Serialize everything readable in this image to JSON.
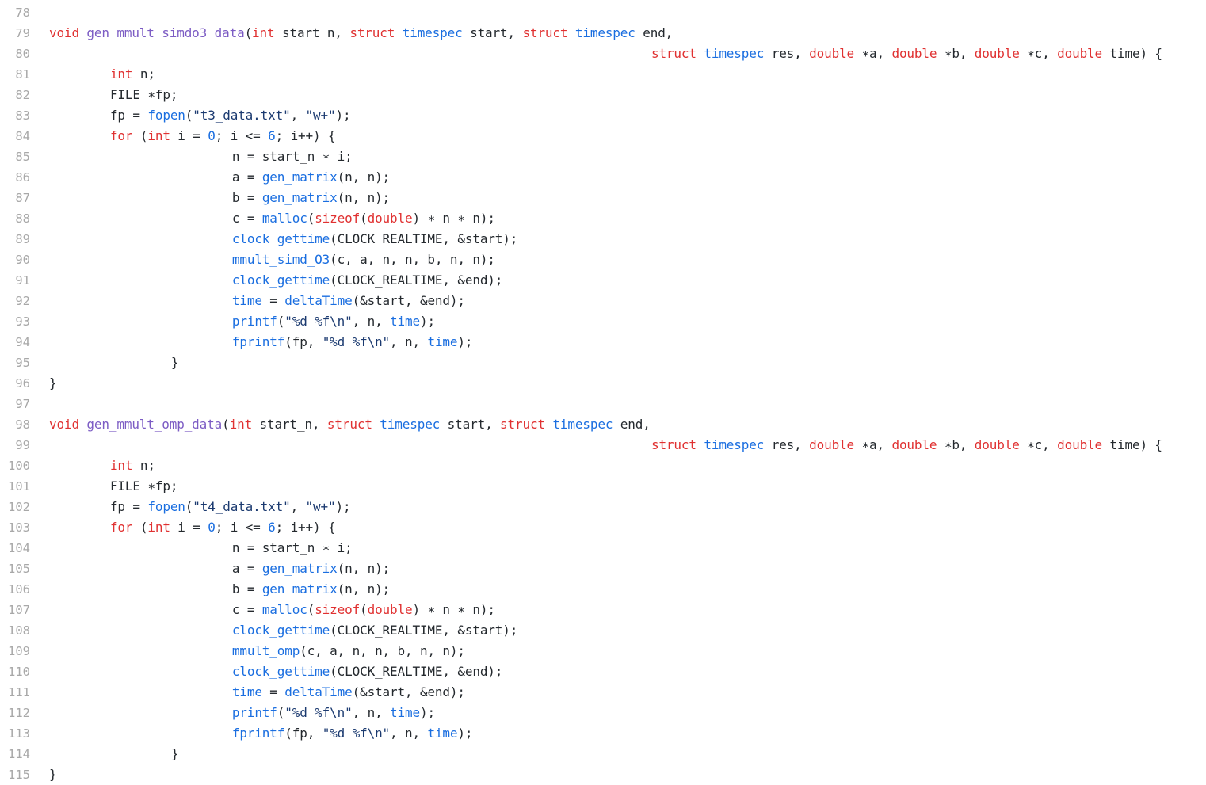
{
  "editor": {
    "language": "C",
    "background": "#ffffff",
    "gutter_color": "#a8a8a8",
    "colors": {
      "plain": "#24292e",
      "keyword": "#e03131",
      "type": "#1a6ee0",
      "function_call": "#1a6ee0",
      "function_def": "#7c5cc4",
      "string": "#1b3a70",
      "number": "#1a6ee0"
    },
    "first_line_number": 78,
    "last_line_number": 115
  },
  "lines": [
    {
      "num": "78",
      "tokens": []
    },
    {
      "num": "79",
      "tokens": [
        {
          "t": "void",
          "c": "keyword"
        },
        {
          "t": " ",
          "c": "plain"
        },
        {
          "t": "gen_mmult_simdo3_data",
          "c": "funcdef"
        },
        {
          "t": "(",
          "c": "plain"
        },
        {
          "t": "int",
          "c": "keyword"
        },
        {
          "t": " start_n, ",
          "c": "plain"
        },
        {
          "t": "struct",
          "c": "keyword"
        },
        {
          "t": " ",
          "c": "plain"
        },
        {
          "t": "timespec",
          "c": "type"
        },
        {
          "t": " start, ",
          "c": "plain"
        },
        {
          "t": "struct",
          "c": "keyword"
        },
        {
          "t": " ",
          "c": "plain"
        },
        {
          "t": "timespec",
          "c": "type"
        },
        {
          "t": " end,",
          "c": "plain"
        }
      ]
    },
    {
      "num": "80",
      "indent": 79,
      "tokens": [
        {
          "t": "struct",
          "c": "keyword"
        },
        {
          "t": " ",
          "c": "plain"
        },
        {
          "t": "timespec",
          "c": "type"
        },
        {
          "t": " res, ",
          "c": "plain"
        },
        {
          "t": "double",
          "c": "keyword"
        },
        {
          "t": " ∗a, ",
          "c": "plain"
        },
        {
          "t": "double",
          "c": "keyword"
        },
        {
          "t": " ∗b, ",
          "c": "plain"
        },
        {
          "t": "double",
          "c": "keyword"
        },
        {
          "t": " ∗c, ",
          "c": "plain"
        },
        {
          "t": "double",
          "c": "keyword"
        },
        {
          "t": " time) {",
          "c": "plain"
        }
      ]
    },
    {
      "num": "81",
      "indent": 8,
      "tokens": [
        {
          "t": "int",
          "c": "keyword"
        },
        {
          "t": " n;",
          "c": "plain"
        }
      ]
    },
    {
      "num": "82",
      "indent": 8,
      "tokens": [
        {
          "t": "FILE ∗fp;",
          "c": "plain"
        }
      ]
    },
    {
      "num": "83",
      "indent": 8,
      "tokens": [
        {
          "t": "fp = ",
          "c": "plain"
        },
        {
          "t": "fopen",
          "c": "func"
        },
        {
          "t": "(",
          "c": "plain"
        },
        {
          "t": "\"t3_data.txt\"",
          "c": "string"
        },
        {
          "t": ", ",
          "c": "plain"
        },
        {
          "t": "\"w+\"",
          "c": "string"
        },
        {
          "t": ");",
          "c": "plain"
        }
      ]
    },
    {
      "num": "84",
      "indent": 8,
      "tokens": [
        {
          "t": "for",
          "c": "keyword"
        },
        {
          "t": " (",
          "c": "plain"
        },
        {
          "t": "int",
          "c": "keyword"
        },
        {
          "t": " i = ",
          "c": "plain"
        },
        {
          "t": "0",
          "c": "number"
        },
        {
          "t": "; i <= ",
          "c": "plain"
        },
        {
          "t": "6",
          "c": "number"
        },
        {
          "t": "; i++) {",
          "c": "plain"
        }
      ]
    },
    {
      "num": "85",
      "indent": 24,
      "tokens": [
        {
          "t": "n = start_n ∗ i;",
          "c": "plain"
        }
      ]
    },
    {
      "num": "86",
      "indent": 24,
      "tokens": [
        {
          "t": "a = ",
          "c": "plain"
        },
        {
          "t": "gen_matrix",
          "c": "func"
        },
        {
          "t": "(n, n);",
          "c": "plain"
        }
      ]
    },
    {
      "num": "87",
      "indent": 24,
      "tokens": [
        {
          "t": "b = ",
          "c": "plain"
        },
        {
          "t": "gen_matrix",
          "c": "func"
        },
        {
          "t": "(n, n);",
          "c": "plain"
        }
      ]
    },
    {
      "num": "88",
      "indent": 24,
      "tokens": [
        {
          "t": "c = ",
          "c": "plain"
        },
        {
          "t": "malloc",
          "c": "func"
        },
        {
          "t": "(",
          "c": "plain"
        },
        {
          "t": "sizeof",
          "c": "keyword"
        },
        {
          "t": "(",
          "c": "plain"
        },
        {
          "t": "double",
          "c": "keyword"
        },
        {
          "t": ") ∗ n ∗ n);",
          "c": "plain"
        }
      ]
    },
    {
      "num": "89",
      "indent": 24,
      "tokens": [
        {
          "t": "clock_gettime",
          "c": "func"
        },
        {
          "t": "(CLOCK_REALTIME, &start);",
          "c": "plain"
        }
      ]
    },
    {
      "num": "90",
      "indent": 24,
      "tokens": [
        {
          "t": "mmult_simd_O3",
          "c": "func"
        },
        {
          "t": "(c, a, n, n, b, n, n);",
          "c": "plain"
        }
      ]
    },
    {
      "num": "91",
      "indent": 24,
      "tokens": [
        {
          "t": "clock_gettime",
          "c": "func"
        },
        {
          "t": "(CLOCK_REALTIME, &end);",
          "c": "plain"
        }
      ]
    },
    {
      "num": "92",
      "indent": 24,
      "tokens": [
        {
          "t": "time",
          "c": "var"
        },
        {
          "t": " = ",
          "c": "plain"
        },
        {
          "t": "deltaTime",
          "c": "func"
        },
        {
          "t": "(&start, &end);",
          "c": "plain"
        }
      ]
    },
    {
      "num": "93",
      "indent": 24,
      "tokens": [
        {
          "t": "printf",
          "c": "func"
        },
        {
          "t": "(",
          "c": "plain"
        },
        {
          "t": "\"%d %f\\n\"",
          "c": "string"
        },
        {
          "t": ", n, ",
          "c": "plain"
        },
        {
          "t": "time",
          "c": "var"
        },
        {
          "t": ");",
          "c": "plain"
        }
      ]
    },
    {
      "num": "94",
      "indent": 24,
      "tokens": [
        {
          "t": "fprintf",
          "c": "func"
        },
        {
          "t": "(fp, ",
          "c": "plain"
        },
        {
          "t": "\"%d %f\\n\"",
          "c": "string"
        },
        {
          "t": ", n, ",
          "c": "plain"
        },
        {
          "t": "time",
          "c": "var"
        },
        {
          "t": ");",
          "c": "plain"
        }
      ]
    },
    {
      "num": "95",
      "indent": 16,
      "tokens": [
        {
          "t": "}",
          "c": "plain"
        }
      ]
    },
    {
      "num": "96",
      "indent": 0,
      "tokens": [
        {
          "t": "}",
          "c": "plain"
        }
      ]
    },
    {
      "num": "97",
      "tokens": []
    },
    {
      "num": "98",
      "tokens": [
        {
          "t": "void",
          "c": "keyword"
        },
        {
          "t": " ",
          "c": "plain"
        },
        {
          "t": "gen_mmult_omp_data",
          "c": "funcdef"
        },
        {
          "t": "(",
          "c": "plain"
        },
        {
          "t": "int",
          "c": "keyword"
        },
        {
          "t": " start_n, ",
          "c": "plain"
        },
        {
          "t": "struct",
          "c": "keyword"
        },
        {
          "t": " ",
          "c": "plain"
        },
        {
          "t": "timespec",
          "c": "type"
        },
        {
          "t": " start, ",
          "c": "plain"
        },
        {
          "t": "struct",
          "c": "keyword"
        },
        {
          "t": " ",
          "c": "plain"
        },
        {
          "t": "timespec",
          "c": "type"
        },
        {
          "t": " end,",
          "c": "plain"
        }
      ]
    },
    {
      "num": "99",
      "indent": 79,
      "tokens": [
        {
          "t": "struct",
          "c": "keyword"
        },
        {
          "t": " ",
          "c": "plain"
        },
        {
          "t": "timespec",
          "c": "type"
        },
        {
          "t": " res, ",
          "c": "plain"
        },
        {
          "t": "double",
          "c": "keyword"
        },
        {
          "t": " ∗a, ",
          "c": "plain"
        },
        {
          "t": "double",
          "c": "keyword"
        },
        {
          "t": " ∗b, ",
          "c": "plain"
        },
        {
          "t": "double",
          "c": "keyword"
        },
        {
          "t": " ∗c, ",
          "c": "plain"
        },
        {
          "t": "double",
          "c": "keyword"
        },
        {
          "t": " time) {",
          "c": "plain"
        }
      ]
    },
    {
      "num": "100",
      "indent": 8,
      "tokens": [
        {
          "t": "int",
          "c": "keyword"
        },
        {
          "t": " n;",
          "c": "plain"
        }
      ]
    },
    {
      "num": "101",
      "indent": 8,
      "tokens": [
        {
          "t": "FILE ∗fp;",
          "c": "plain"
        }
      ]
    },
    {
      "num": "102",
      "indent": 8,
      "tokens": [
        {
          "t": "fp = ",
          "c": "plain"
        },
        {
          "t": "fopen",
          "c": "func"
        },
        {
          "t": "(",
          "c": "plain"
        },
        {
          "t": "\"t4_data.txt\"",
          "c": "string"
        },
        {
          "t": ", ",
          "c": "plain"
        },
        {
          "t": "\"w+\"",
          "c": "string"
        },
        {
          "t": ");",
          "c": "plain"
        }
      ]
    },
    {
      "num": "103",
      "indent": 8,
      "tokens": [
        {
          "t": "for",
          "c": "keyword"
        },
        {
          "t": " (",
          "c": "plain"
        },
        {
          "t": "int",
          "c": "keyword"
        },
        {
          "t": " i = ",
          "c": "plain"
        },
        {
          "t": "0",
          "c": "number"
        },
        {
          "t": "; i <= ",
          "c": "plain"
        },
        {
          "t": "6",
          "c": "number"
        },
        {
          "t": "; i++) {",
          "c": "plain"
        }
      ]
    },
    {
      "num": "104",
      "indent": 24,
      "tokens": [
        {
          "t": "n = start_n ∗ i;",
          "c": "plain"
        }
      ]
    },
    {
      "num": "105",
      "indent": 24,
      "tokens": [
        {
          "t": "a = ",
          "c": "plain"
        },
        {
          "t": "gen_matrix",
          "c": "func"
        },
        {
          "t": "(n, n);",
          "c": "plain"
        }
      ]
    },
    {
      "num": "106",
      "indent": 24,
      "tokens": [
        {
          "t": "b = ",
          "c": "plain"
        },
        {
          "t": "gen_matrix",
          "c": "func"
        },
        {
          "t": "(n, n);",
          "c": "plain"
        }
      ]
    },
    {
      "num": "107",
      "indent": 24,
      "tokens": [
        {
          "t": "c = ",
          "c": "plain"
        },
        {
          "t": "malloc",
          "c": "func"
        },
        {
          "t": "(",
          "c": "plain"
        },
        {
          "t": "sizeof",
          "c": "keyword"
        },
        {
          "t": "(",
          "c": "plain"
        },
        {
          "t": "double",
          "c": "keyword"
        },
        {
          "t": ") ∗ n ∗ n);",
          "c": "plain"
        }
      ]
    },
    {
      "num": "108",
      "indent": 24,
      "tokens": [
        {
          "t": "clock_gettime",
          "c": "func"
        },
        {
          "t": "(CLOCK_REALTIME, &start);",
          "c": "plain"
        }
      ]
    },
    {
      "num": "109",
      "indent": 24,
      "tokens": [
        {
          "t": "mmult_omp",
          "c": "func"
        },
        {
          "t": "(c, a, n, n, b, n, n);",
          "c": "plain"
        }
      ]
    },
    {
      "num": "110",
      "indent": 24,
      "tokens": [
        {
          "t": "clock_gettime",
          "c": "func"
        },
        {
          "t": "(CLOCK_REALTIME, &end);",
          "c": "plain"
        }
      ]
    },
    {
      "num": "111",
      "indent": 24,
      "tokens": [
        {
          "t": "time",
          "c": "var"
        },
        {
          "t": " = ",
          "c": "plain"
        },
        {
          "t": "deltaTime",
          "c": "func"
        },
        {
          "t": "(&start, &end);",
          "c": "plain"
        }
      ]
    },
    {
      "num": "112",
      "indent": 24,
      "tokens": [
        {
          "t": "printf",
          "c": "func"
        },
        {
          "t": "(",
          "c": "plain"
        },
        {
          "t": "\"%d %f\\n\"",
          "c": "string"
        },
        {
          "t": ", n, ",
          "c": "plain"
        },
        {
          "t": "time",
          "c": "var"
        },
        {
          "t": ");",
          "c": "plain"
        }
      ]
    },
    {
      "num": "113",
      "indent": 24,
      "tokens": [
        {
          "t": "fprintf",
          "c": "func"
        },
        {
          "t": "(fp, ",
          "c": "plain"
        },
        {
          "t": "\"%d %f\\n\"",
          "c": "string"
        },
        {
          "t": ", n, ",
          "c": "plain"
        },
        {
          "t": "time",
          "c": "var"
        },
        {
          "t": ");",
          "c": "plain"
        }
      ]
    },
    {
      "num": "114",
      "indent": 16,
      "tokens": [
        {
          "t": "}",
          "c": "plain"
        }
      ]
    },
    {
      "num": "115",
      "indent": 0,
      "tokens": [
        {
          "t": "}",
          "c": "plain"
        }
      ]
    }
  ]
}
